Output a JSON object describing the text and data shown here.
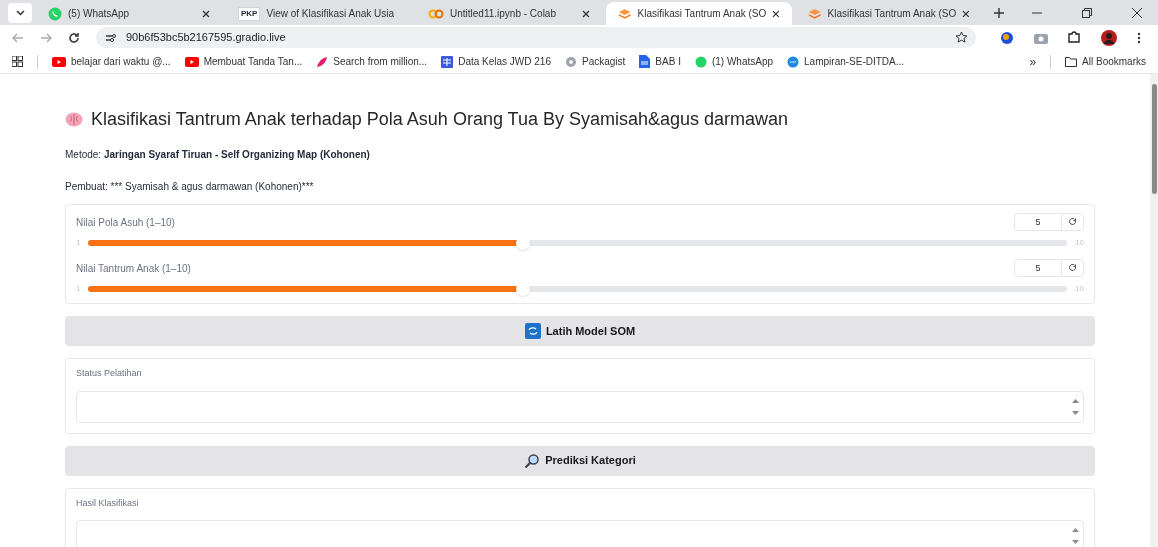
{
  "browser": {
    "tabs": [
      {
        "title": "(5) WhatsApp",
        "kind": "whatsapp",
        "selected": false
      },
      {
        "title": "View of Klasifikasi Anak Usia",
        "kind": "pkp",
        "selected": false
      },
      {
        "title": "Untitled11.ipynb - Colab",
        "kind": "colab",
        "selected": false
      },
      {
        "title": "Klasifikasi Tantrum Anak (SO",
        "kind": "gradio",
        "selected": true
      },
      {
        "title": "Klasifikasi Tantrum Anak (SO",
        "kind": "gradio",
        "selected": false
      }
    ],
    "pkp_label": "PKP",
    "url": "90b6f53bc5b2167595.gradio.live",
    "bookmarks": [
      {
        "title": "belajar dari waktu @...",
        "kind": "youtube"
      },
      {
        "title": "Membuat Tanda Tan...",
        "kind": "youtube"
      },
      {
        "title": "Search from million...",
        "kind": "leaf"
      },
      {
        "title": "Data Kelas JWD 216",
        "kind": "sheet"
      },
      {
        "title": "Packagist",
        "kind": "packagist"
      },
      {
        "title": "BAB I",
        "kind": "doc"
      },
      {
        "title": "(1) WhatsApp",
        "kind": "whatsapp"
      },
      {
        "title": "Lampiran-SE-DITDA...",
        "kind": "globe"
      }
    ],
    "more": "»",
    "all_bookmarks": "All Bookmarks"
  },
  "app": {
    "title": "Klasifikasi Tantrum Anak terhadap Pola Asuh Orang Tua By Syamisah&agus darmawan",
    "method": "Metode: **Jaringan Syaraf Tiruan - Self Organizing Map (Kohonen)**",
    "author": "Pembuat: *** Syamisah & agus darmawan (Kohonen)***",
    "sliders": [
      {
        "label": "Nilai Pola Asuh (1–10)",
        "value": "5",
        "min": "1",
        "max": "10",
        "level": 0.444
      },
      {
        "label": "Nilai Tantrum Anak (1–10)",
        "value": "5",
        "min": "1",
        "max": "10",
        "level": 0.444
      }
    ],
    "sections": [
      {
        "button": "Latih Model SOM",
        "kind": "refresh",
        "output_label": "Status Pelatihan"
      },
      {
        "button": "Prediksi Kategori",
        "kind": "search",
        "output_label": "Hasil Klasifikasi"
      }
    ]
  }
}
